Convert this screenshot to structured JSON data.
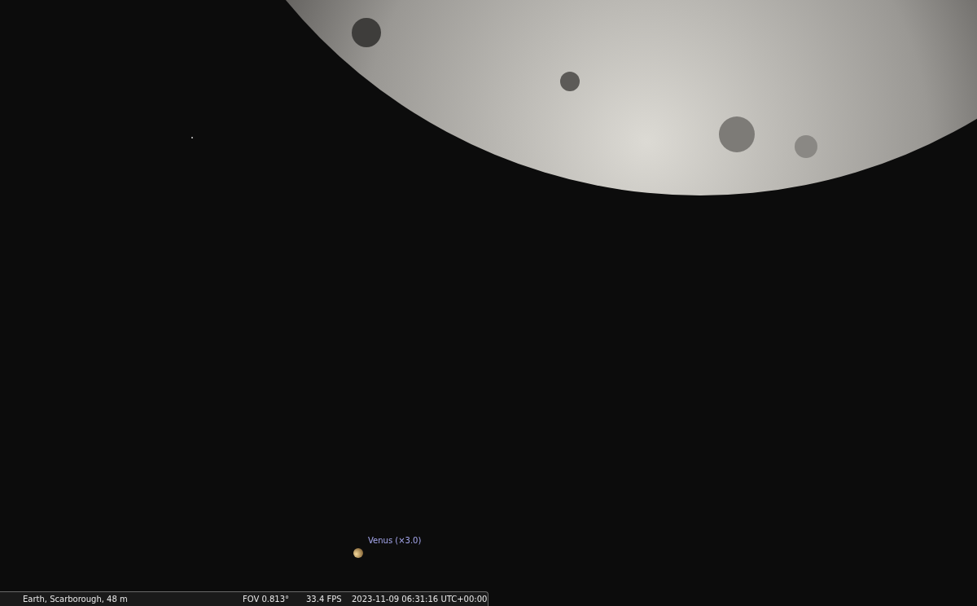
{
  "sky": {
    "object_label": "Venus (×3.0)"
  },
  "status_bar": {
    "location": "Earth, Scarborough, 48 m",
    "fov": "FOV 0.813°",
    "fps": "33.4 FPS",
    "datetime": "2023-11-09 06:31:16 UTC+00:00"
  }
}
